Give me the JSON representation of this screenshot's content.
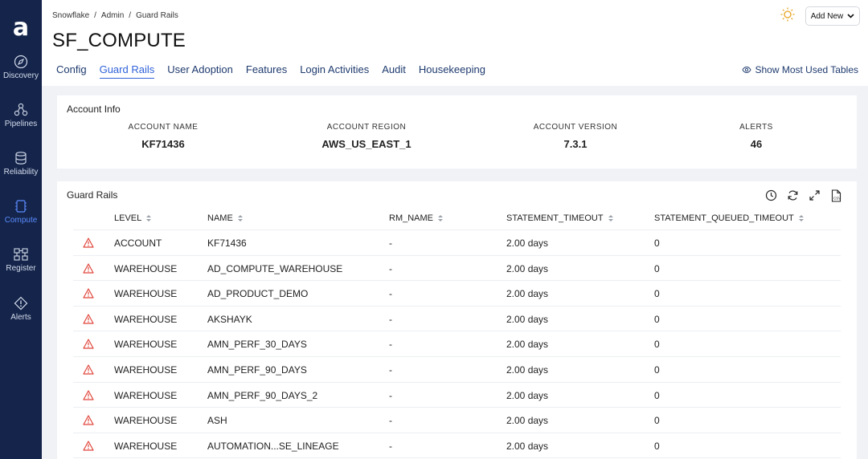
{
  "app": {
    "logo": "a",
    "nav": [
      {
        "label": "Discovery",
        "icon": "compass-icon"
      },
      {
        "label": "Pipelines",
        "icon": "pipelines-icon"
      },
      {
        "label": "Reliability",
        "icon": "database-icon"
      },
      {
        "label": "Compute",
        "icon": "cpu-icon",
        "active": true
      },
      {
        "label": "Register",
        "icon": "register-icon"
      },
      {
        "label": "Alerts",
        "icon": "alert-diamond-icon"
      }
    ]
  },
  "header": {
    "breadcrumb": [
      "Snowflake",
      "Admin",
      "Guard Rails"
    ],
    "title": "SF_COMPUTE",
    "add_new": "Add New",
    "show_tables": "Show Most Used Tables",
    "tabs": [
      "Config",
      "Guard Rails",
      "User Adoption",
      "Features",
      "Login Activities",
      "Audit",
      "Housekeeping"
    ],
    "active_tab": "Guard Rails"
  },
  "account_info": {
    "title": "Account Info",
    "stats": [
      {
        "label": "ACCOUNT NAME",
        "value": "KF71436"
      },
      {
        "label": "ACCOUNT REGION",
        "value": "AWS_US_EAST_1"
      },
      {
        "label": "ACCOUNT VERSION",
        "value": "7.3.1"
      },
      {
        "label": "ALERTS",
        "value": "46"
      }
    ]
  },
  "guard_rails": {
    "title": "Guard Rails",
    "tools": [
      "clock-icon",
      "refresh-icon",
      "expand-icon",
      "csv-export-icon"
    ],
    "columns": [
      "LEVEL",
      "NAME",
      "RM_NAME",
      "STATEMENT_TIMEOUT",
      "STATEMENT_QUEUED_TIMEOUT"
    ],
    "rows": [
      {
        "level": "ACCOUNT",
        "name": "KF71436",
        "rm_name": "-",
        "timeout": "2.00 days",
        "queued": "0"
      },
      {
        "level": "WAREHOUSE",
        "name": "AD_COMPUTE_WAREHOUSE",
        "rm_name": "-",
        "timeout": "2.00 days",
        "queued": "0"
      },
      {
        "level": "WAREHOUSE",
        "name": "AD_PRODUCT_DEMO",
        "rm_name": "-",
        "timeout": "2.00 days",
        "queued": "0"
      },
      {
        "level": "WAREHOUSE",
        "name": "AKSHAYK",
        "rm_name": "-",
        "timeout": "2.00 days",
        "queued": "0"
      },
      {
        "level": "WAREHOUSE",
        "name": "AMN_PERF_30_DAYS",
        "rm_name": "-",
        "timeout": "2.00 days",
        "queued": "0"
      },
      {
        "level": "WAREHOUSE",
        "name": "AMN_PERF_90_DAYS",
        "rm_name": "-",
        "timeout": "2.00 days",
        "queued": "0"
      },
      {
        "level": "WAREHOUSE",
        "name": "AMN_PERF_90_DAYS_2",
        "rm_name": "-",
        "timeout": "2.00 days",
        "queued": "0"
      },
      {
        "level": "WAREHOUSE",
        "name": "ASH",
        "rm_name": "-",
        "timeout": "2.00 days",
        "queued": "0"
      },
      {
        "level": "WAREHOUSE",
        "name": "AUTOMATION...SE_LINEAGE",
        "rm_name": "-",
        "timeout": "2.00 days",
        "queued": "0"
      }
    ]
  },
  "colors": {
    "sidebar": "#14244a",
    "accent": "#2f62d9",
    "warning": "#e0453a"
  }
}
